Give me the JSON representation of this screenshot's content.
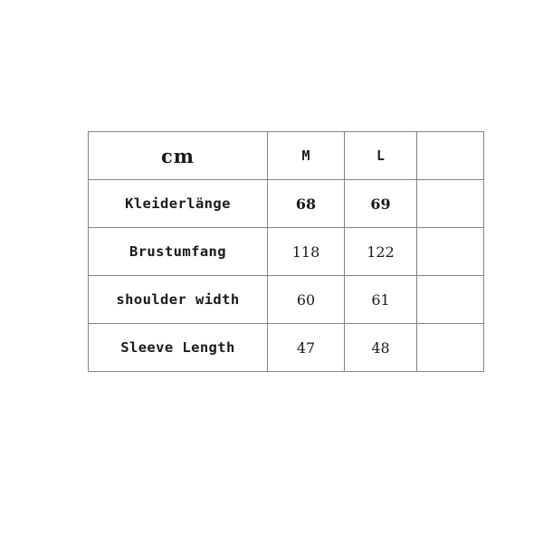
{
  "chart_data": {
    "type": "table",
    "title": "",
    "unit_label": "cm",
    "columns": [
      "cm",
      "M",
      "L",
      ""
    ],
    "categories": [
      "Kleiderlänge",
      "Brustumfang",
      "shoulder width",
      "Sleeve Length"
    ],
    "series": [
      {
        "name": "M",
        "values": [
          68,
          118,
          60,
          47
        ]
      },
      {
        "name": "L",
        "values": [
          69,
          122,
          61,
          48
        ]
      }
    ],
    "legend_position": "none",
    "grid": true
  },
  "table": {
    "unit_header": "cm",
    "size_headers": [
      "M",
      "L",
      ""
    ],
    "rows": [
      {
        "label": "Kleiderlänge",
        "m": "68",
        "l": "69",
        "extra": "",
        "emphasis": true
      },
      {
        "label": "Brustumfang",
        "m": "118",
        "l": "122",
        "extra": "",
        "emphasis": false
      },
      {
        "label": "shoulder width",
        "m": "60",
        "l": "61",
        "extra": "",
        "emphasis": false
      },
      {
        "label": "Sleeve Length",
        "m": "47",
        "l": "48",
        "extra": "",
        "emphasis": false
      }
    ]
  },
  "colors": {
    "border": "#848484",
    "text": "#1a1a1a",
    "background": "#ffffff"
  }
}
